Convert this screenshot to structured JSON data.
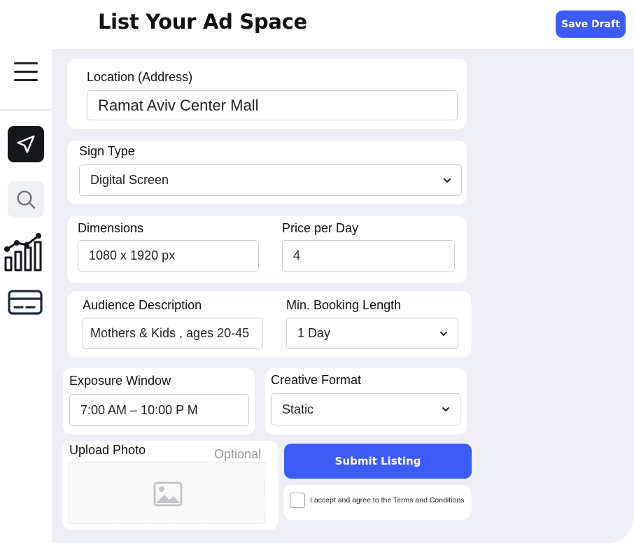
{
  "header": {
    "title": "List Your Ad Space",
    "save_draft_label": "Save Draft"
  },
  "sidebar": {
    "items": [
      {
        "name": "menu",
        "icon": "hamburger-menu-icon"
      },
      {
        "name": "send",
        "icon": "send-arrow-icon",
        "active": true
      },
      {
        "name": "search",
        "icon": "search-icon"
      },
      {
        "name": "analytics",
        "icon": "bar-chart-trend-icon"
      },
      {
        "name": "payments",
        "icon": "credit-card-icon"
      }
    ]
  },
  "form": {
    "location": {
      "label": "Location (Address)",
      "value": "Ramat Aviv Center Mall"
    },
    "sign_type": {
      "label": "Sign Type",
      "value": "Digital Screen"
    },
    "dimensions": {
      "label": "Dimensions",
      "value": "1080 x 1920 px"
    },
    "price_per_day": {
      "label": "Price per Day",
      "value": "4"
    },
    "audience_description": {
      "label": "Audience Description",
      "value": "Mothers & Kids  , ages 20-45"
    },
    "min_booking_length": {
      "label": "Min. Booking Length",
      "value": "1 Day"
    },
    "exposure_window": {
      "label": "Exposure Window",
      "value": "7:00 AM – 10:00 P M"
    },
    "creative_format": {
      "label": "Creative Format",
      "value": "Static"
    },
    "upload_photo": {
      "label": "Upload Photo",
      "optional_text": "Optional",
      "icon": "image-placeholder-icon"
    },
    "submit_label": "Submit Listing",
    "terms_text": "I accept and agree to the Terms and Conditions"
  },
  "colors": {
    "accent": "#3d5cf5",
    "background": "#eeeff4",
    "active_nav": "#16171b"
  }
}
